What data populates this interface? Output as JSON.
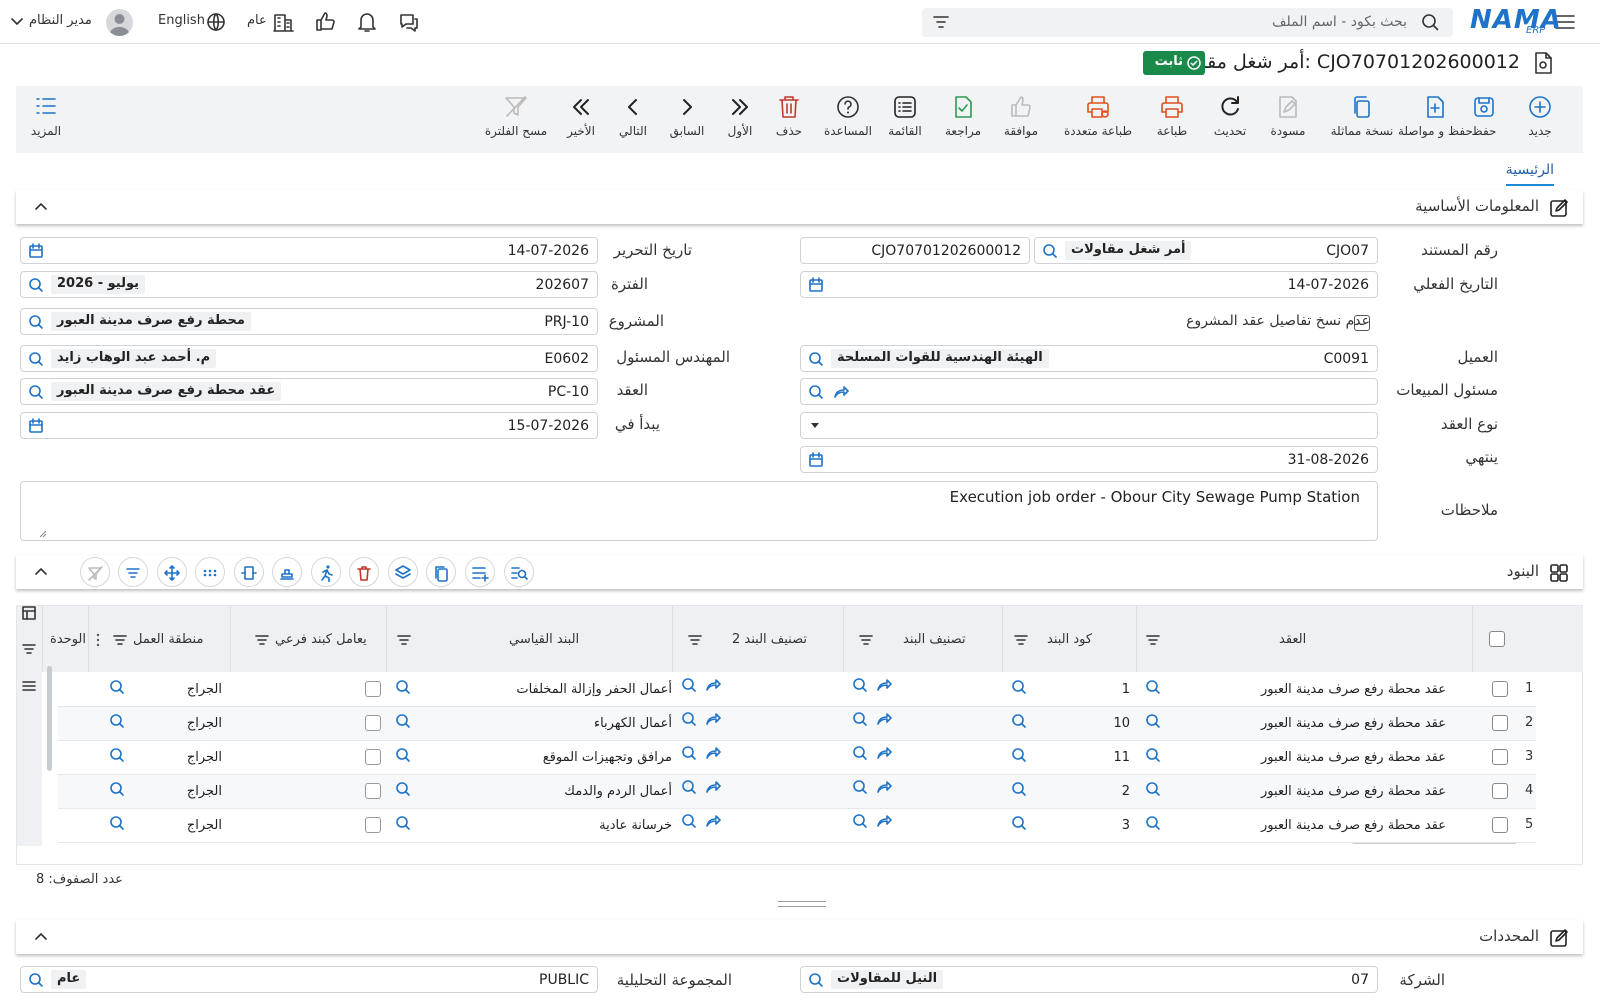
{
  "topbar": {
    "search_placeholder": "بحث بكود - اسم الملف",
    "user": "مدير النظام",
    "language": "English",
    "scope": "عام",
    "logo_text": "NAMA",
    "logo_sub": "ERP"
  },
  "page": {
    "title": "أمر شغل مقاولات: CJO70701202600012",
    "status_badge": "ثابت"
  },
  "toolbar": {
    "items": [
      {
        "label": "جديد",
        "icon": "plus-circle-icon"
      },
      {
        "label": "حفظ",
        "icon": "save-icon"
      },
      {
        "label": "حفظ و مواصلة",
        "icon": "save-continue-icon"
      },
      {
        "label": "نسخة مماثلة",
        "icon": "copy-icon"
      },
      {
        "label": "مسودة",
        "icon": "draft-icon"
      },
      {
        "label": "تحديث",
        "icon": "refresh-icon"
      },
      {
        "label": "طباعة",
        "icon": "print-icon"
      },
      {
        "label": "طباعة متعددة",
        "icon": "multi-print-icon"
      },
      {
        "label": "موافقة",
        "icon": "thumbs-up-icon"
      },
      {
        "label": "مراجعة",
        "icon": "review-icon"
      },
      {
        "label": "القائمة",
        "icon": "list-icon"
      },
      {
        "label": "المساعدة",
        "icon": "help-icon"
      },
      {
        "label": "حذف",
        "icon": "trash-icon"
      },
      {
        "label": "الأول",
        "icon": "first-icon"
      },
      {
        "label": "السابق",
        "icon": "previous-icon"
      },
      {
        "label": "التالي",
        "icon": "next-icon"
      },
      {
        "label": "الأخير",
        "icon": "last-icon"
      },
      {
        "label": "مسح الفلترة",
        "icon": "clear-filter-icon"
      }
    ],
    "more_label": "المزيد"
  },
  "tabs": {
    "main": "الرئيسية"
  },
  "basic_info": {
    "section_title": "المعلومات الأساسية",
    "doc_number_label": "رقم المستند",
    "doc_prefix": "CJO07",
    "doc_type": "أمر شغل مقاولات",
    "doc_number": "CJO70701202600012",
    "actual_date_label": "التاريخ الفعلي",
    "actual_date": "14-07-2026",
    "no_copy_label": "عدم نسخ تفاصيل عقد المشروع",
    "customer_label": "العميل",
    "customer_code": "C0091",
    "customer_name": "الهيئة الهندسية للقوات المسلحة",
    "sales_rep_label": "مسئول المبيعات",
    "contract_type_label": "نوع العقد",
    "ends_label": "ينتهي",
    "ends_date": "31-08-2026",
    "edit_date_label": "تاريخ التحرير",
    "edit_date": "14-07-2026",
    "period_label": "الفترة",
    "period_code": "202607",
    "period_name": "2026 - يوليو",
    "project_label": "المشروع",
    "project_code": "PRJ-10",
    "project_name": "محطة رفع صرف مدينة العبور",
    "engineer_label": "المهندس المسئول",
    "engineer_code": "E0602",
    "engineer_name": "م. أحمد عبد الوهاب زايد",
    "contract_label": "العقد",
    "contract_code": "PC-10",
    "contract_name": "عقد محطة رفع صرف مدينة العبور",
    "starts_label": "يبدأ في",
    "starts_date": "15-07-2026",
    "notes_label": "ملاحظات",
    "notes": "Execution job order - Obour City Sewage Pump Station"
  },
  "items_section": {
    "section_title": "البنود",
    "columns": {
      "contract": "العقد",
      "item_code": "كود البند",
      "item_class": "تصنيف البند",
      "item_class2": "تصنيف البند 2",
      "standard_item": "البند القياسي",
      "sub_item": "يعامل كبند فرعي",
      "work_area": "منطقة العمل",
      "unit": "الوحدة"
    },
    "rows": [
      {
        "n": "1",
        "contract": "عقد محطة رفع صرف مدينة العبور",
        "code": "1",
        "standard": "أعمال الحفر وإزالة المخلفات",
        "area": "الجراج"
      },
      {
        "n": "2",
        "contract": "عقد محطة رفع صرف مدينة العبور",
        "code": "10",
        "standard": "أعمال الكهرباء",
        "area": "الجراج"
      },
      {
        "n": "3",
        "contract": "عقد محطة رفع صرف مدينة العبور",
        "code": "11",
        "standard": "مرافق وتجهيزات الموقع",
        "area": "الجراج"
      },
      {
        "n": "4",
        "contract": "عقد محطة رفع صرف مدينة العبور",
        "code": "2",
        "standard": "أعمال الردم والدمك",
        "area": "الجراج"
      },
      {
        "n": "5",
        "contract": "عقد محطة رفع صرف مدينة العبور",
        "code": "3",
        "standard": "خرسانة عادية",
        "area": "الجراج"
      }
    ],
    "row_count": "عدد الصفوف: 8"
  },
  "dimensions": {
    "section_title": "المحددات",
    "company_label": "الشركة",
    "company_code": "07",
    "company_name": "النيل للمقاولات",
    "analytic_label": "المجموعة التحليلية",
    "analytic_code": "PUBLIC",
    "analytic_name": "عام"
  },
  "colors": {
    "accent": "#1e73c8",
    "badge": "#1a8a4a",
    "print": "#e0501e",
    "delete": "#c0392b",
    "approve": "#2e9b4f"
  }
}
